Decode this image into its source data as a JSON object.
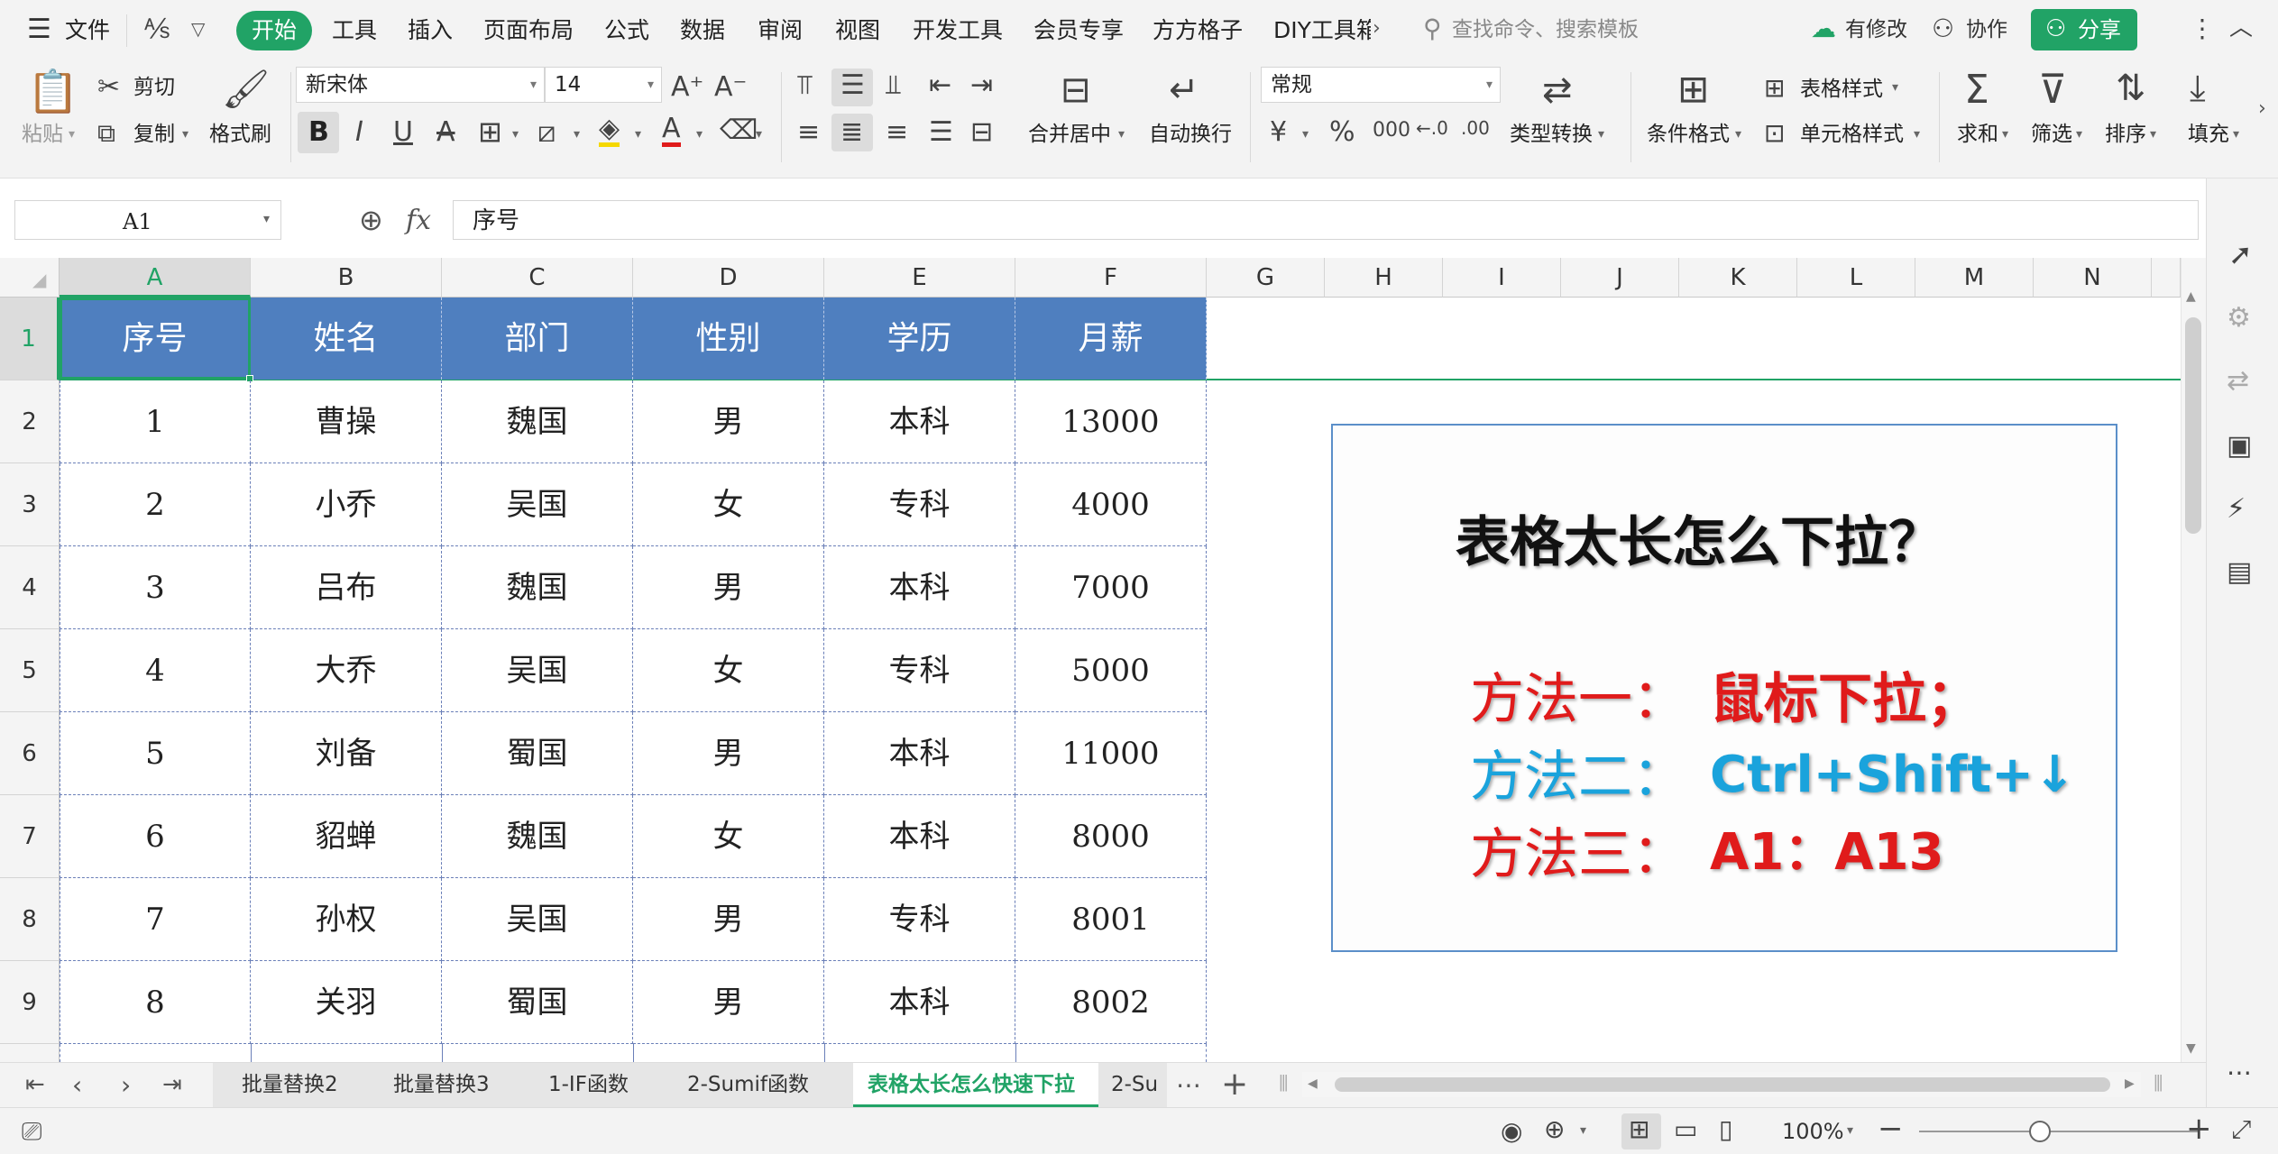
{
  "menubar": {
    "file_label": "文件",
    "tabs": [
      "开始",
      "工具",
      "插入",
      "页面布局",
      "公式",
      "数据",
      "审阅",
      "视图",
      "开发工具",
      "会员专享",
      "方方格子",
      "DIY工具箱"
    ],
    "search_placeholder": "查找命令、搜索模板",
    "modified_label": "有修改",
    "collab_label": "协作",
    "share_label": "分享"
  },
  "toolbar": {
    "paste": "粘贴",
    "cut": "剪切",
    "copy": "复制",
    "format_painter": "格式刷",
    "font_name": "新宋体",
    "font_size": "14",
    "merge_center": "合并居中",
    "wrap_text": "自动换行",
    "number_format": "常规",
    "type_convert": "类型转换",
    "conditional_format": "条件格式",
    "table_style": "表格样式",
    "cell_style": "单元格样式",
    "sum": "求和",
    "filter": "筛选",
    "sort": "排序",
    "fill": "填充"
  },
  "formula_bar": {
    "name_box": "A1",
    "fx_label": "fx",
    "content": "序号"
  },
  "columns": [
    "A",
    "B",
    "C",
    "D",
    "E",
    "F",
    "G",
    "H",
    "I",
    "J",
    "K",
    "L",
    "M",
    "N"
  ],
  "rows": [
    "1",
    "2",
    "3",
    "4",
    "5",
    "6",
    "7",
    "8",
    "9"
  ],
  "table": {
    "headers": [
      "序号",
      "姓名",
      "部门",
      "性别",
      "学历",
      "月薪"
    ],
    "rows": [
      [
        "1",
        "曹操",
        "魏国",
        "男",
        "本科",
        "13000"
      ],
      [
        "2",
        "小乔",
        "吴国",
        "女",
        "专科",
        "4000"
      ],
      [
        "3",
        "吕布",
        "魏国",
        "男",
        "本科",
        "7000"
      ],
      [
        "4",
        "大乔",
        "吴国",
        "女",
        "专科",
        "5000"
      ],
      [
        "5",
        "刘备",
        "蜀国",
        "男",
        "本科",
        "11000"
      ],
      [
        "6",
        "貂蝉",
        "魏国",
        "女",
        "本科",
        "8000"
      ],
      [
        "7",
        "孙权",
        "吴国",
        "男",
        "专科",
        "8001"
      ],
      [
        "8",
        "关羽",
        "蜀国",
        "男",
        "本科",
        "8002"
      ]
    ]
  },
  "note": {
    "title": "表格太长怎么下拉？",
    "method1_prefix": "方法一：",
    "method1_text": "鼠标下拉；",
    "method2_prefix": "方法二：",
    "method2_text": "Ctrl+Shift+↓",
    "method3_prefix": "方法三：",
    "method3_text": "A1：A13",
    "colors": {
      "red": "#e01b1b",
      "blue": "#1aa3dc",
      "title": "#111111"
    }
  },
  "sheets": {
    "tabs": [
      "批量替换2",
      "批量替换3",
      "1-IF函数",
      "2-Sumif函数",
      "表格太长怎么快速下拉",
      "2-Su"
    ],
    "active_index": 4,
    "more": "⋯",
    "add": "+"
  },
  "statusbar": {
    "zoom": "100%"
  },
  "colors": {
    "accent": "#21a366",
    "header_fill": "#4f7fbf"
  }
}
